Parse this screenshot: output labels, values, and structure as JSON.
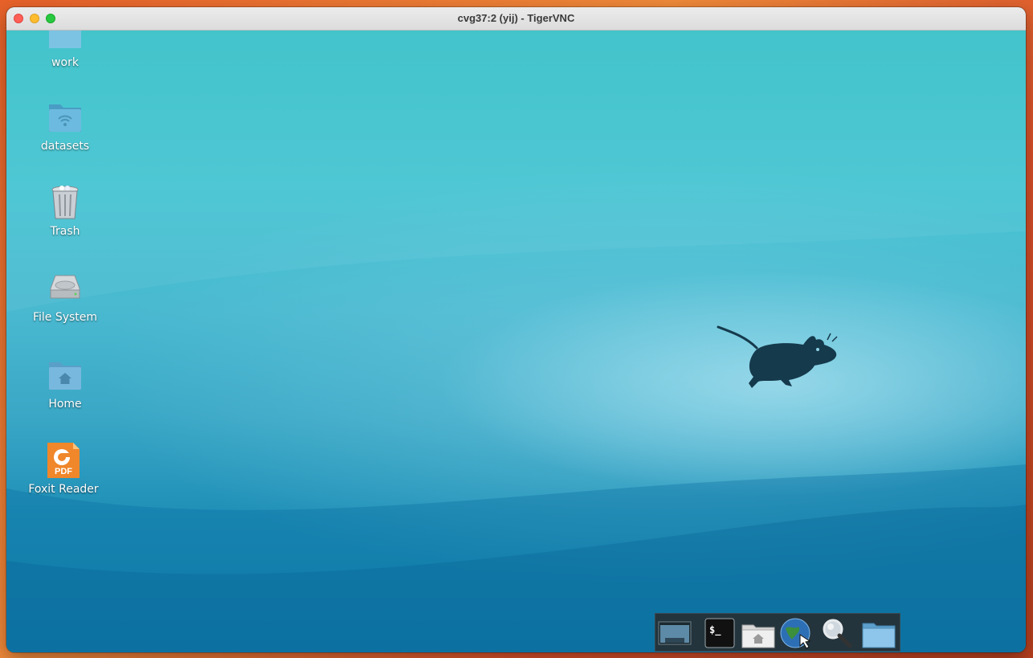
{
  "window": {
    "title": "cvg37:2 (yij) - TigerVNC"
  },
  "desktop": {
    "icons": [
      {
        "label": "work",
        "icon": "folder-icon"
      },
      {
        "label": "datasets",
        "icon": "network-folder-icon"
      },
      {
        "label": "Trash",
        "icon": "trash-icon"
      },
      {
        "label": "File System",
        "icon": "drive-icon"
      },
      {
        "label": "Home",
        "icon": "home-folder-icon"
      },
      {
        "label": "Foxit Reader",
        "icon": "pdf-icon",
        "badge": "PDF"
      }
    ],
    "wallpaper_logo": "xfce-mouse-icon"
  },
  "dock": {
    "items": [
      {
        "name": "show-desktop",
        "icon": "desktop-icon"
      },
      {
        "name": "terminal",
        "icon": "terminal-icon",
        "glyph": "$_"
      },
      {
        "name": "file-manager",
        "icon": "home-folder-icon"
      },
      {
        "name": "web-browser",
        "icon": "globe-icon"
      },
      {
        "name": "app-finder",
        "icon": "magnifier-icon"
      },
      {
        "name": "folder",
        "icon": "folder-icon"
      }
    ]
  },
  "colors": {
    "accent": "#1f8fb0",
    "close": "#ff5f57",
    "minimize": "#febc2e",
    "maximize": "#28c840",
    "mouse_logo": "#153a4c"
  }
}
